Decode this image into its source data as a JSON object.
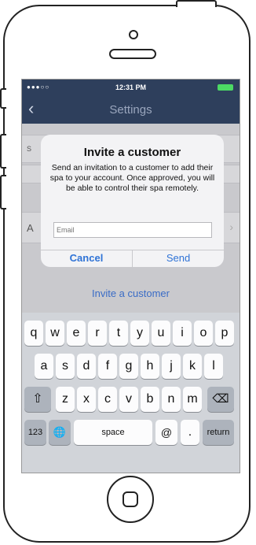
{
  "status": {
    "signal": "●●●○○",
    "time": "12:31 PM"
  },
  "nav": {
    "title": "Settings",
    "back": "‹"
  },
  "background": {
    "row1_letter": "S",
    "row3_letter": "A",
    "chevron": "›",
    "invite_link": "Invite a customer"
  },
  "dialog": {
    "title": "Invite a customer",
    "message": "Send an invitation to a customer to add their spa to your account. Once approved, you will be able to control their spa remotely.",
    "input_placeholder": "Email",
    "cancel": "Cancel",
    "send": "Send"
  },
  "keyboard": {
    "row1": [
      "q",
      "w",
      "e",
      "r",
      "t",
      "y",
      "u",
      "i",
      "o",
      "p"
    ],
    "row2": [
      "a",
      "s",
      "d",
      "f",
      "g",
      "h",
      "j",
      "k",
      "l"
    ],
    "row3": [
      "z",
      "x",
      "c",
      "v",
      "b",
      "n",
      "m"
    ],
    "shift": "⇧",
    "delete": "⌫",
    "num": "123",
    "globe": "🌐",
    "space": "space",
    "at": "@",
    "dot": ".",
    "return": "return"
  }
}
